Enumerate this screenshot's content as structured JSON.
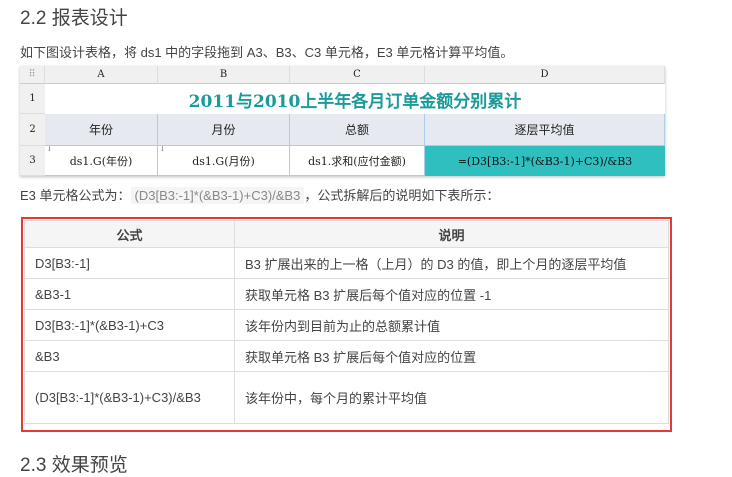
{
  "headings": {
    "h22": "2.2 报表设计",
    "h23": "2.3 效果预览"
  },
  "intro": "如下图设计表格，将 ds1 中的字段拖到 A3、B3、C3 单元格，E3 单元格计算平均值。",
  "sheet": {
    "columns": [
      "A",
      "B",
      "C",
      "D"
    ],
    "rows": [
      "1",
      "2",
      "3"
    ],
    "title": "2011与2010上半年各月订单金额分别累计",
    "headers": [
      "年份",
      "月份",
      "总额",
      "逐层平均值"
    ],
    "cells": [
      "ds1.G(年份)",
      "ds1.G(月份)",
      "ds1.求和(应付金额)",
      "=(D3[B3:-1]*(&B3-1)+C3)/&B3"
    ],
    "accent": "#2fbfbf"
  },
  "formula_line": {
    "prefix": "E3 单元格公式为：",
    "code": "(D3[B3:-1]*(&B3-1)+C3)/&B3",
    "suffix": "，公式拆解后的说明如下表所示："
  },
  "table": {
    "headers": [
      "公式",
      "说明"
    ],
    "rows": [
      [
        "D3[B3:-1]",
        "B3 扩展出来的上一格（上月）的 D3 的值，即上个月的逐层平均值"
      ],
      [
        "&B3-1",
        "获取单元格 B3 扩展后每个值对应的位置 -1"
      ],
      [
        "D3[B3:-1]*(&B3-1)+C3",
        "该年份内到目前为止的总额累计值"
      ],
      [
        "&B3",
        "获取单元格 B3 扩展后每个值对应的位置"
      ],
      [
        "(D3[B3:-1]*(&B3-1)+C3)/&B3",
        "该年份中，每个月的累计平均值"
      ]
    ]
  }
}
